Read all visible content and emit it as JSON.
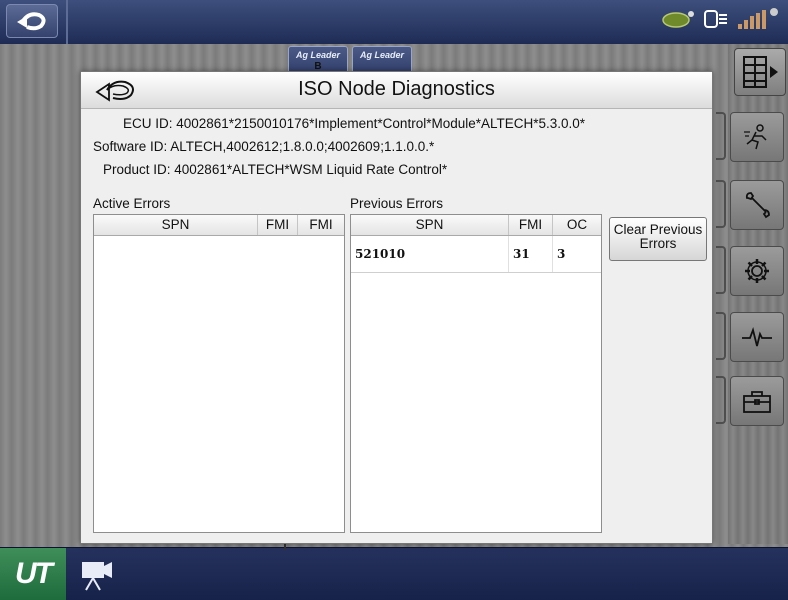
{
  "topbar": {
    "back_icon": "back-arrow-icon",
    "status_icons": [
      "leaf-icon",
      "display-connect-icon",
      "gps-signal-icon"
    ]
  },
  "background": {
    "tabs": [
      {
        "brand": "Ag Leader",
        "sub": "B"
      },
      {
        "brand": "Ag Leader",
        "sub": ""
      }
    ]
  },
  "sidebar": {
    "buttons": [
      "runner-icon",
      "wrench-icon",
      "gear-icon",
      "diagnostics-wave-icon",
      "toolbox-icon"
    ],
    "grid_button_icon": "grid-menu-icon"
  },
  "bottombar": {
    "ut_label": "UT",
    "camera_icon": "camera-icon"
  },
  "dialog": {
    "title": "ISO Node Diagnostics",
    "ecu_id": "ECU ID: 4002861*2150010176*Implement*Control*Module*ALTECH*5.3.0.0*",
    "software_id": "Software ID: ALTECH,4002612;1.8.0.0;4002609;1.1.0.0.*",
    "product_id": "Product ID: 4002861*ALTECH*WSM Liquid Rate Control*",
    "active_errors": {
      "label": "Active Errors",
      "columns": [
        "SPN",
        "FMI",
        "FMI"
      ],
      "rows": []
    },
    "previous_errors": {
      "label": "Previous Errors",
      "columns": [
        "SPN",
        "FMI",
        "OC"
      ],
      "rows": [
        {
          "spn": "521010",
          "fmi": "31",
          "oc": "3"
        }
      ]
    },
    "clear_button": "Clear Previous Errors"
  },
  "colors": {
    "topbar": "#2a3866",
    "ut_green": "#2e7d47",
    "dialog_bg": "#efefef"
  }
}
